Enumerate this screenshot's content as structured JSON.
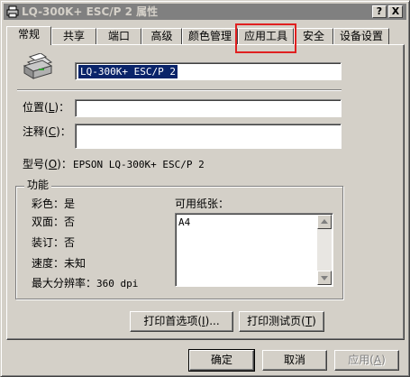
{
  "window": {
    "title": "LQ-300K+ ESC/P 2 属性",
    "help_button": "?",
    "close_button": "X"
  },
  "tabs": [
    {
      "label": "常规",
      "active": true
    },
    {
      "label": "共享"
    },
    {
      "label": "端口"
    },
    {
      "label": "高级"
    },
    {
      "label": "颜色管理"
    },
    {
      "label": "应用工具",
      "highlighted": true
    },
    {
      "label": "安全"
    },
    {
      "label": "设备设置"
    }
  ],
  "general": {
    "printer_name": "LQ-300K+ ESC/P 2",
    "location": {
      "label_prefix": "位置",
      "accel": "L",
      "label_suffix": ")：",
      "paren_open": "(",
      "value": ""
    },
    "comment": {
      "label_prefix": "注释",
      "accel": "C",
      "label_suffix": ")：",
      "paren_open": "(",
      "value": ""
    },
    "model": {
      "label_prefix": "型号",
      "paren_open": "(",
      "accel": "O",
      "label_suffix": ")：",
      "value": "EPSON LQ-300K+ ESC/P 2"
    }
  },
  "features": {
    "title": "功能",
    "color": "彩色：是",
    "duplex": "双面：否",
    "staple": "装订：否",
    "speed": "速度：未知",
    "max_resolution": "最大分辨率：",
    "max_resolution_value": "360 dpi",
    "paper_label": "可用纸张：",
    "paper_list": [
      "A4"
    ]
  },
  "buttons": {
    "print_prefs": "打印首选项",
    "print_prefs_accel": "I",
    "print_prefs_tail": ")...",
    "test_page": "打印测试页",
    "test_page_accel": "T",
    "test_page_tail": ")",
    "paren_open": "(",
    "ok": "确定",
    "cancel": "取消",
    "apply": "应用",
    "apply_accel": "A",
    "apply_tail": ")"
  },
  "colors": {
    "highlight_box": "#e02020",
    "selection": "#0a246a",
    "titlebar_inactive": "#808080"
  }
}
